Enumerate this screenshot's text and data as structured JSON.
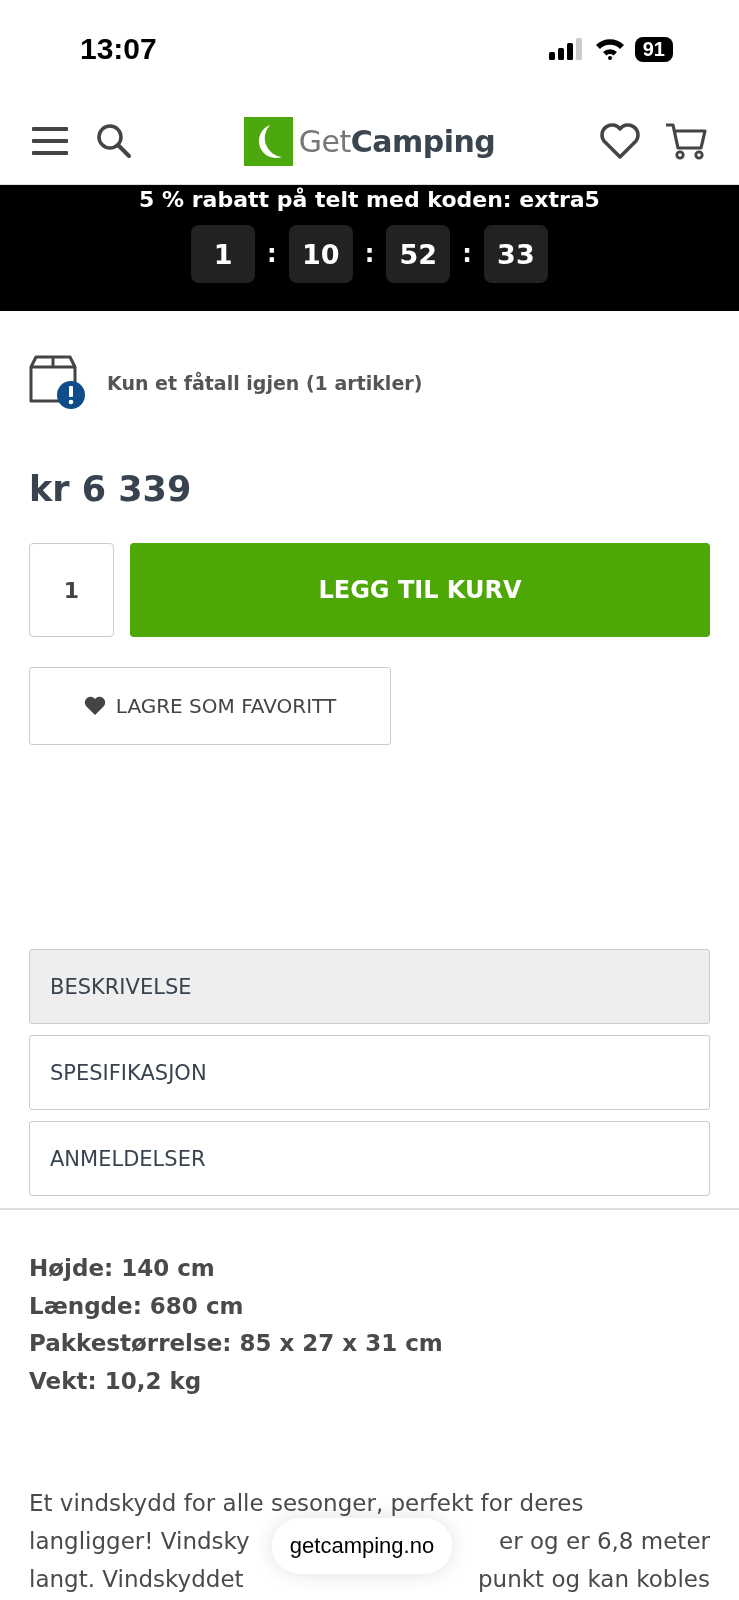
{
  "status_bar": {
    "time": "13:07",
    "battery": "91"
  },
  "header": {
    "logo": {
      "light": "Get",
      "bold": "Camping"
    }
  },
  "promo": {
    "text": "5 % rabatt på telt med koden: extra5",
    "countdown": [
      "1",
      "10",
      "52",
      "33"
    ],
    "separator": ":"
  },
  "stock": {
    "text": "Kun et fåtall igjen (1 artikler)"
  },
  "price": "kr 6 339",
  "quantity": "1",
  "add_to_cart": "LEGG TIL KURV",
  "favorite": "LAGRE SOM FAVORITT",
  "tabs": [
    {
      "label": "BESKRIVELSE",
      "selected": true
    },
    {
      "label": "SPESIFIKASJON",
      "selected": false
    },
    {
      "label": "ANMELDELSER",
      "selected": false
    }
  ],
  "specs": [
    "Højde: 140 cm",
    "Længde: 680 cm",
    "Pakkestørrelse: 85 x 27 x 31 cm",
    "Vekt: 10,2 kg"
  ],
  "description_lines": [
    [
      "Et vindskydd for alle sesonger, perfekt for deres"
    ],
    [
      "langligger! Vindsky",
      "er og er 6,8 meter"
    ],
    [
      "langt. Vindskyddet",
      "punkt og kan kobles"
    ]
  ],
  "url_pill": "getcamping.no"
}
